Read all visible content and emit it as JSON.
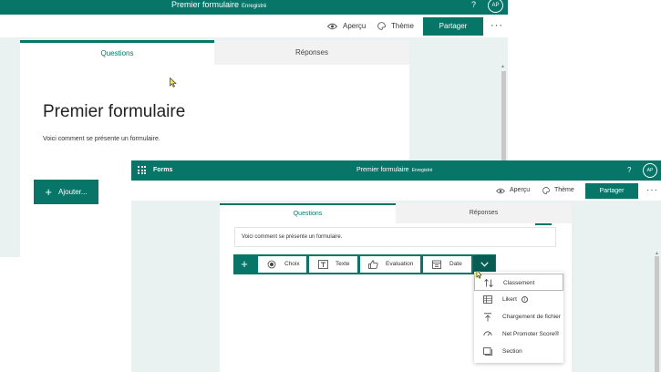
{
  "back_window": {
    "title": "Premier formulaire",
    "saved_status": "Enregistré",
    "help": "?",
    "avatar": "AP",
    "preview_label": "Aperçu",
    "theme_label": "Thème",
    "share_label": "Partager",
    "more_label": "···",
    "tab_questions": "Questions",
    "tab_responses": "Réponses",
    "form_title": "Premier formulaire",
    "form_description": "Voici comment se présente un formulaire.",
    "add_label": "Ajouter..."
  },
  "front_window": {
    "app_name": "Forms",
    "title": "Premier formulaire",
    "saved_status": "Enregistré",
    "help": "?",
    "avatar": "AP",
    "preview_label": "Aperçu",
    "theme_label": "Thème",
    "share_label": "Partager",
    "more_label": "···",
    "tab_questions": "Questions",
    "tab_responses": "Réponses",
    "form_description": "Voici comment se présente un formulaire.",
    "question_types": {
      "add": "+",
      "choice": "Choix",
      "text": "Texte",
      "rating": "Evaluation",
      "date": "Date"
    }
  },
  "dropdown_menu": {
    "items": [
      {
        "label": "Classement",
        "icon": "ranking-icon"
      },
      {
        "label": "Likert",
        "icon": "likert-icon"
      },
      {
        "label": "Chargement de fichier",
        "icon": "upload-icon"
      },
      {
        "label": "Net Promoter Score®",
        "icon": "nps-icon"
      },
      {
        "label": "Section",
        "icon": "section-icon"
      }
    ]
  },
  "colors": {
    "accent": "#077568",
    "accent_dark": "#055d53",
    "background": "#e9f1f1"
  }
}
